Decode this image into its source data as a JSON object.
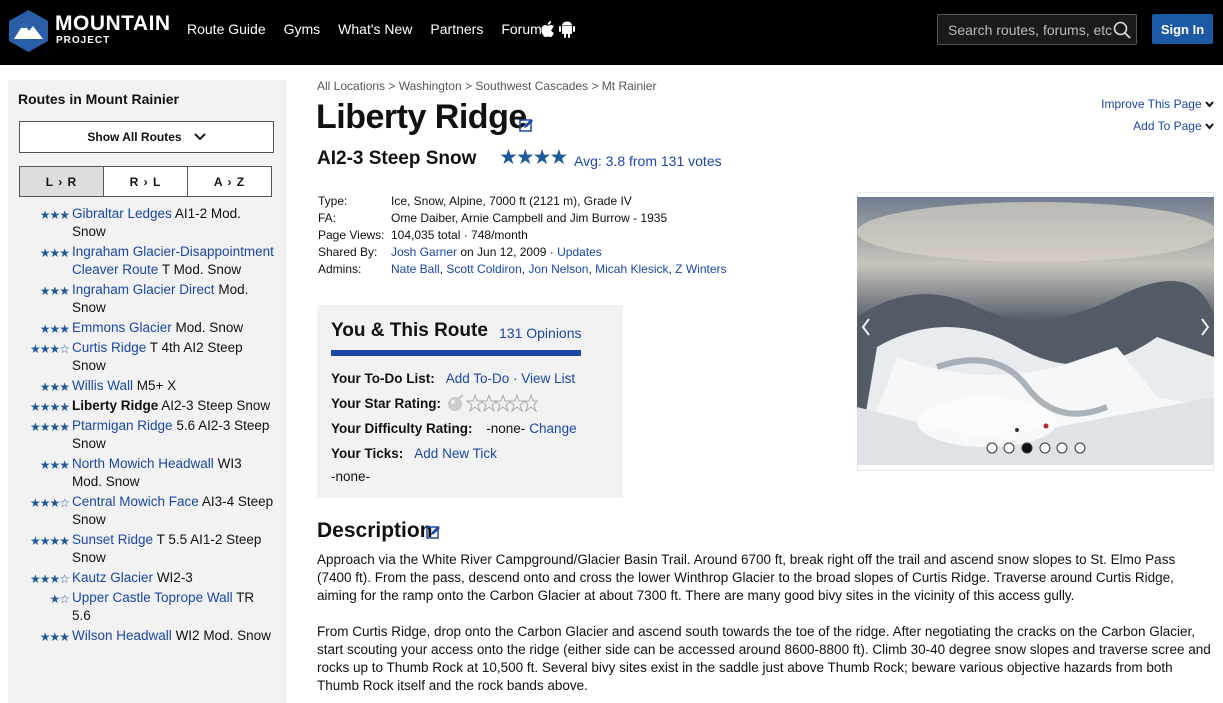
{
  "header": {
    "logo_line1": "MOUNTAIN",
    "logo_line2": "PROJECT",
    "nav": [
      "Route Guide",
      "Gyms",
      "What's New",
      "Partners",
      "Forum"
    ],
    "search_placeholder": "Search routes, forums, etc",
    "signin_label": "Sign In"
  },
  "sidebar": {
    "title": "Routes in Mount Rainier",
    "show_all_label": "Show All Routes",
    "sort_buttons": [
      "L › R",
      "R › L",
      "A › Z"
    ],
    "routes": [
      {
        "stars": "★★★",
        "name": "Gibraltar Ledges",
        "grade": "AI1-2 Mod. Snow"
      },
      {
        "stars": "★★★",
        "name": "Ingraham Glacier-Disappointment Cleaver Route",
        "grade": "T Mod. Snow"
      },
      {
        "stars": "★★★",
        "name": "Ingraham Glacier Direct",
        "grade": "Mod. Snow"
      },
      {
        "stars": "★★★",
        "name": "Emmons Glacier",
        "grade": "Mod. Snow"
      },
      {
        "stars": "★★★☆",
        "name": "Curtis Ridge",
        "grade": "T 4th AI2 Steep Snow"
      },
      {
        "stars": "★★★",
        "name": "Willis Wall",
        "grade": "M5+ X"
      },
      {
        "stars": "★★★★",
        "name": "Liberty Ridge",
        "grade": "AI2-3 Steep Snow"
      },
      {
        "stars": "★★★★",
        "name": "Ptarmigan Ridge",
        "grade": "5.6 AI2-3 Steep Snow"
      },
      {
        "stars": "★★★",
        "name": "North Mowich Headwall",
        "grade": "WI3 Mod. Snow"
      },
      {
        "stars": "★★★☆",
        "name": "Central Mowich Face",
        "grade": "AI3-4 Steep Snow"
      },
      {
        "stars": "★★★★",
        "name": "Sunset Ridge",
        "grade": "T 5.5 AI1-2 Steep Snow"
      },
      {
        "stars": "★★★☆",
        "name": "Kautz Glacier",
        "grade": "WI2-3"
      },
      {
        "stars": "★☆",
        "name": "Upper Castle Toprope Wall",
        "grade": "TR 5.6"
      },
      {
        "stars": "★★★",
        "name": "Wilson Headwall",
        "grade": "WI2 Mod. Snow"
      }
    ]
  },
  "breadcrumb": [
    "All Locations",
    "Washington",
    "Southwest Cascades",
    "Mt Rainier"
  ],
  "route": {
    "title": "Liberty Ridge",
    "grade": "AI2-3 Steep Snow",
    "stars": "★★★★",
    "avg_text": "Avg: 3.8 from 131 votes"
  },
  "page_links": {
    "improve": "Improve This Page",
    "add": "Add To Page"
  },
  "details": {
    "type_label": "Type:",
    "type": "Ice, Snow, Alpine, 7000 ft (2121 m), Grade IV",
    "fa_label": "FA:",
    "fa": "Ome Daiber, Arnie Campbell and Jim Burrow - 1935",
    "views_label": "Page Views:",
    "views": "104,035 total · 748/month",
    "shared_label": "Shared By:",
    "shared_user": "Josh Garner",
    "shared_date": " on Jun 12, 2009 · ",
    "updates": "Updates",
    "admins_label": "Admins:",
    "admins": [
      "Nate Ball",
      "Scott Coldiron",
      "Jon Nelson",
      "Micah Klesick",
      "Z Winters"
    ]
  },
  "you_route": {
    "title": "You & This Route",
    "opinions": "131 Opinions",
    "todo_label": "Your To-Do List:",
    "todo_add": "Add To-Do",
    "todo_view": "View List",
    "star_label": "Your Star Rating:",
    "difficulty_label": "Your Difficulty Rating:",
    "difficulty_value": "-none-",
    "difficulty_change": "Change",
    "ticks_label": "Your Ticks:",
    "ticks_add": "Add New Tick",
    "ticks_value": "-none-"
  },
  "photo": {
    "active_dot": 3,
    "dot_count": 6
  },
  "description": {
    "title": "Description",
    "p1": "Approach via the White River Campground/Glacier Basin Trail.  Around 6700 ft, break right off the trail and ascend snow slopes to St. Elmo Pass (7400 ft).  From the pass, descend onto and cross the lower Winthrop Glacier to the broad slopes of Curtis Ridge.  Traverse around Curtis Ridge, aiming for the ramp onto the Carbon Glacier at about 7300 ft.  There are many good bivy sites in the vicinity of this access gully.",
    "p2": "From Curtis Ridge, drop onto the Carbon Glacier and ascend south towards the toe of the ridge.  After negotiating the cracks on the Carbon Glacier, start scouting your access onto the ridge (either side can be accessed around 8600-8800 ft). Climb 30-40 degree snow slopes and traverse scree and rocks up to Thumb Rock at 10,500 ft.  Several bivy sites exist in the saddle just above Thumb Rock; beware various objective hazards from both Thumb Rock itself and the rock bands above."
  },
  "colors": {
    "brand_blue": "#1c5aa6",
    "link": "#1a47a8",
    "star": "#1e5a9a"
  }
}
